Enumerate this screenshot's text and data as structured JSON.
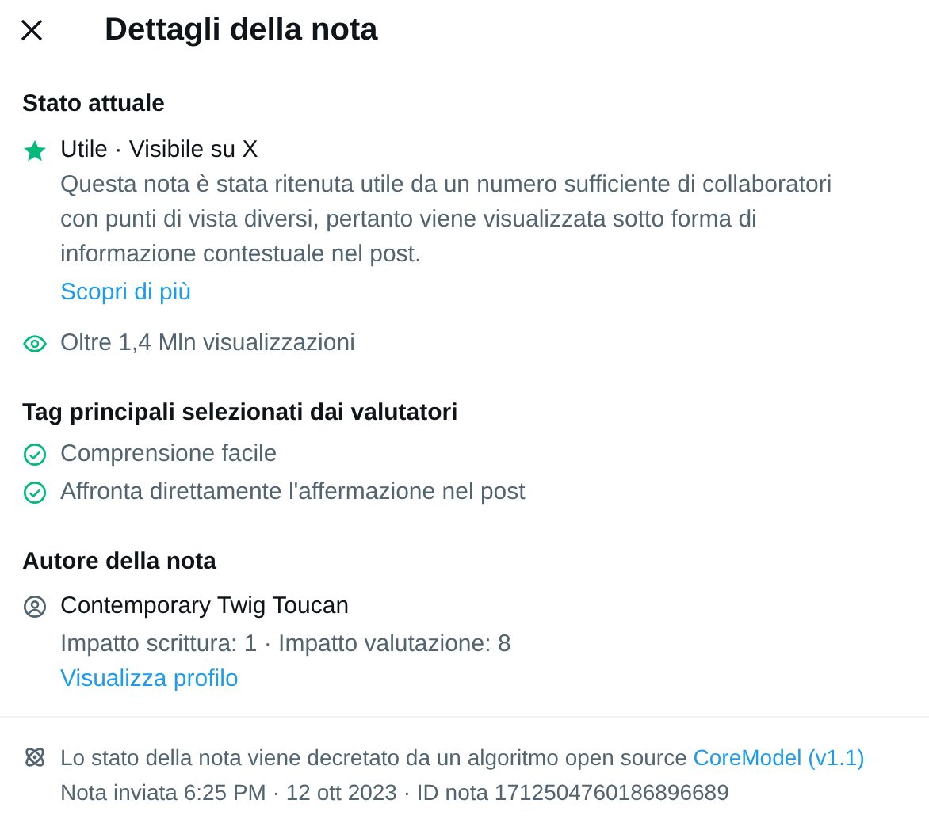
{
  "header": {
    "title": "Dettagli della nota"
  },
  "status": {
    "heading": "Stato attuale",
    "label": "Utile · Visibile su X",
    "description": [
      "Questa nota è stata ritenuta utile da un numero sufficiente di collaboratori",
      "con punti di vista diversi, pertanto viene visualizzata sotto forma di",
      "informazione contestuale nel post."
    ],
    "link": "Scopri di più",
    "views": "Oltre 1,4 Mln visualizzazioni"
  },
  "tags": {
    "heading": "Tag principali selezionati dai valutatori",
    "items": [
      {
        "label": "Comprensione facile"
      },
      {
        "label": "Affronta direttamente l'affermazione nel post"
      }
    ]
  },
  "author": {
    "heading": "Autore della nota",
    "name": "Contemporary Twig Toucan",
    "impact": "Impatto scrittura: 1 · Impatto valutazione: 8",
    "link": "Visualizza profilo"
  },
  "footer": {
    "text": "Lo stato della nota viene decretato da un algoritmo open source",
    "link": "CoreModel (v1.1)",
    "meta": "Nota inviata 6:25 PM · 12 ott 2023 · ID nota 1712504760186896689"
  }
}
